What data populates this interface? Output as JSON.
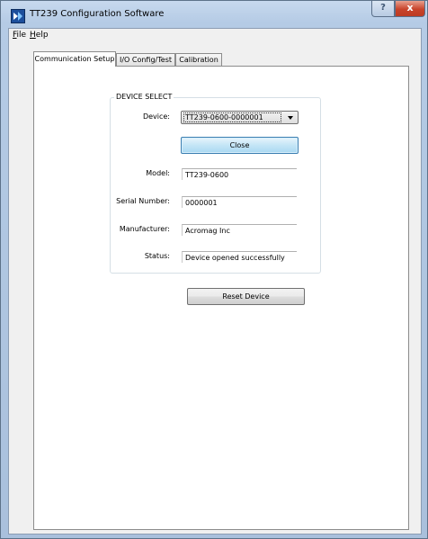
{
  "window": {
    "title": "TT239 Configuration Software",
    "help_glyph": "?",
    "close_glyph": "x"
  },
  "menu": {
    "file": {
      "mnemonic": "F",
      "rest": "ile"
    },
    "help": {
      "mnemonic": "H",
      "rest": "elp"
    }
  },
  "tabs": [
    {
      "label": "Communication Setup",
      "active": true
    },
    {
      "label": "I/O Config/Test",
      "active": false
    },
    {
      "label": "Calibration",
      "active": false
    }
  ],
  "device_select": {
    "group_title": "DEVICE SELECT",
    "device_label": "Device:",
    "device_value": "TT239-0600-0000001",
    "close_button": "Close",
    "model_label": "Model:",
    "model_value": "TT239-0600",
    "serial_label": "Serial Number:",
    "serial_value": "0000001",
    "manufacturer_label": "Manufacturer:",
    "manufacturer_value": "Acromag Inc",
    "status_label": "Status:",
    "status_value": "Device opened successfully"
  },
  "reset_button": "Reset Device",
  "colors": {
    "titlebar_glass": "#b5cbe5",
    "close_button_red": "#c8432a",
    "focused_button_blue": "#c4e5f6"
  },
  "icons": {
    "app": "tt239-app-icon",
    "dropdown": "chevron-down-icon"
  }
}
